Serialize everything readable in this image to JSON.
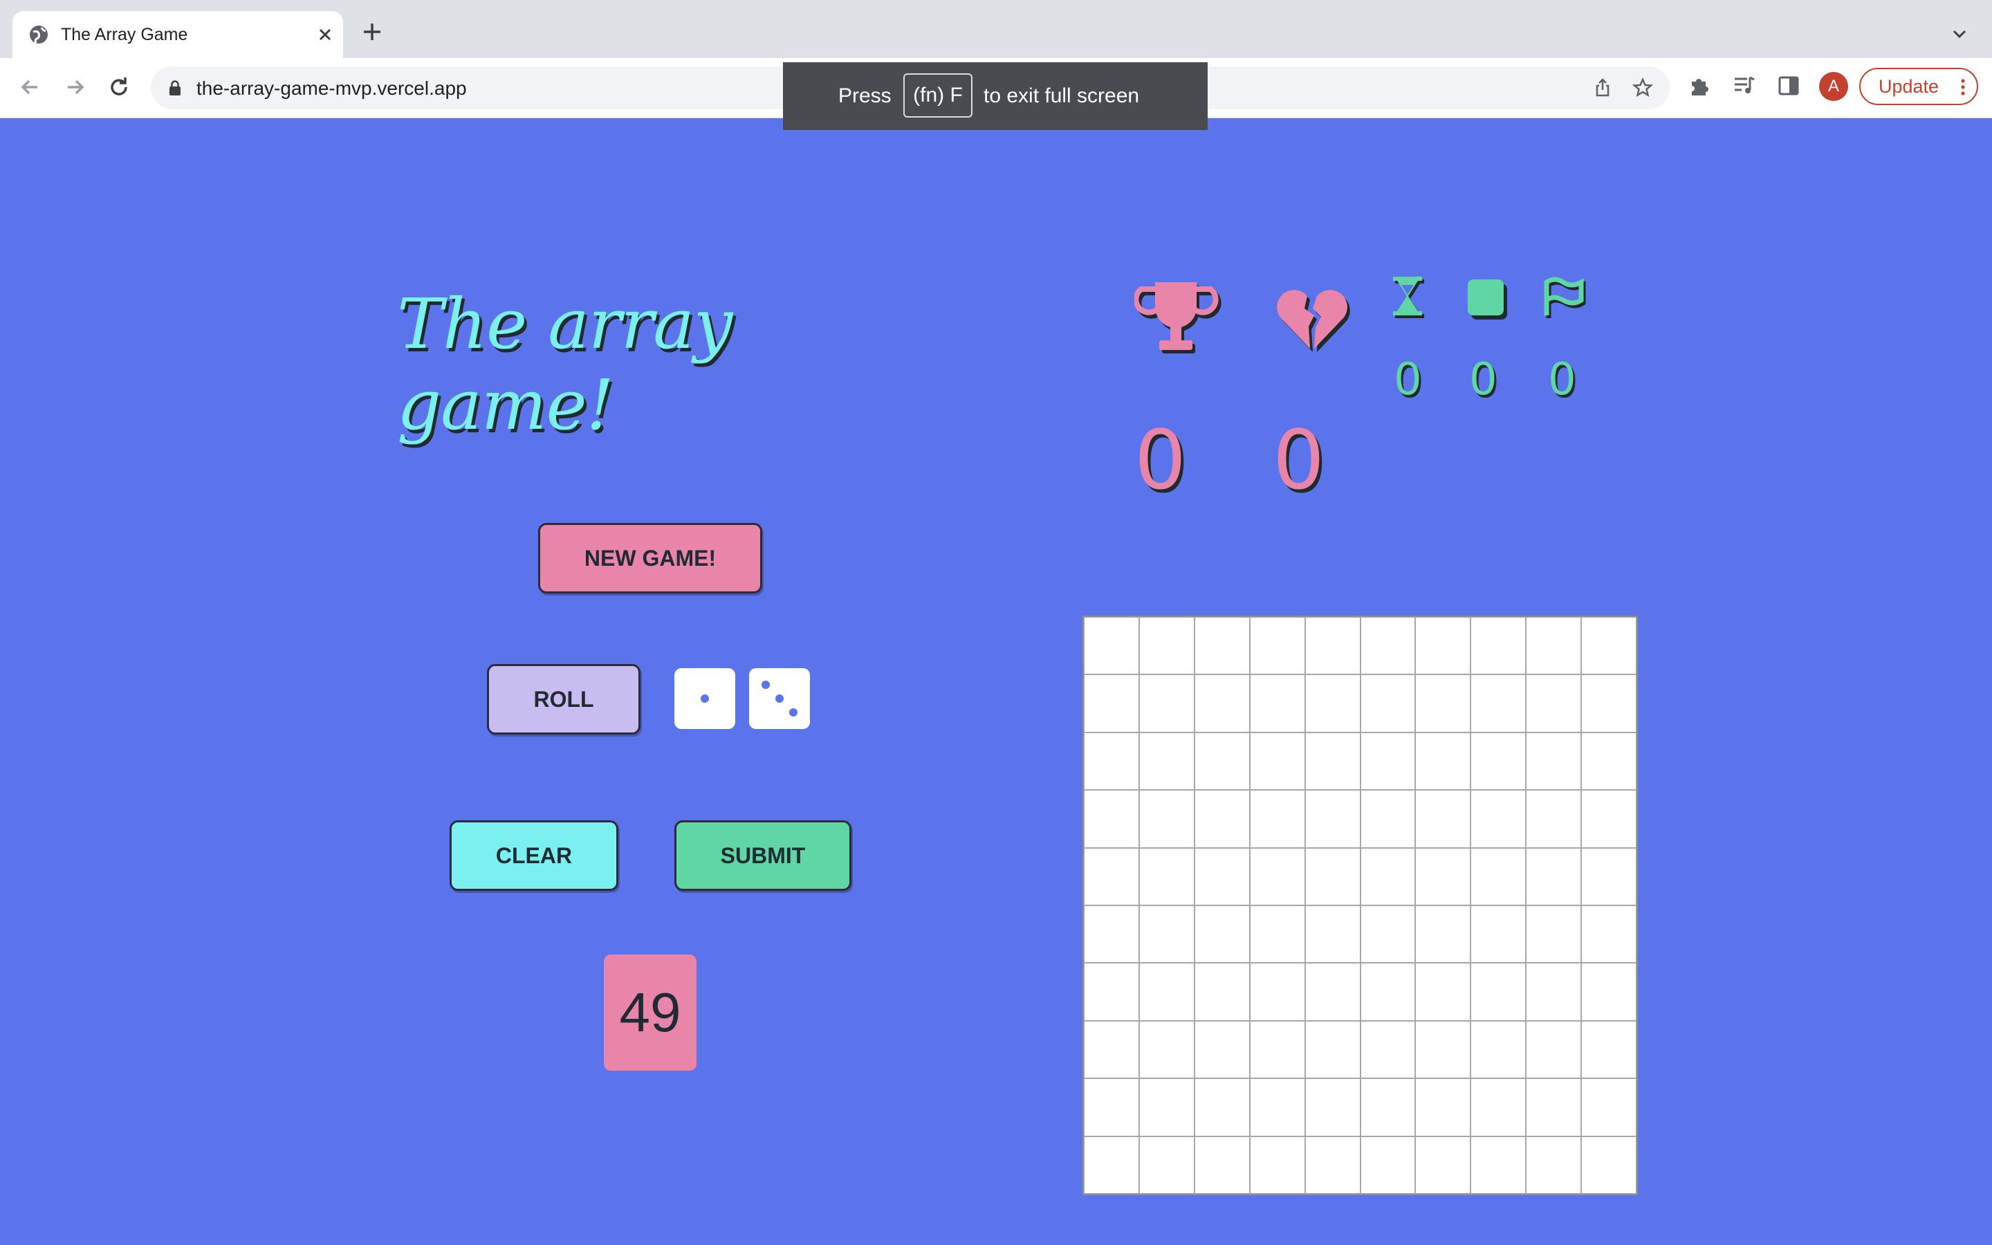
{
  "browser": {
    "tab_title": "The Array Game",
    "url": "the-array-game-mvp.vercel.app",
    "profile_initial": "A",
    "update_label": "Update"
  },
  "fullscreen_hint": {
    "press": "Press",
    "key": "(fn) F",
    "rest": "to exit full screen"
  },
  "game": {
    "title": "The array game!",
    "stats": {
      "wins": "0",
      "losses": "0",
      "timer": "0",
      "squares": "0",
      "flags": "0"
    },
    "buttons": {
      "new_game": "NEW GAME!",
      "roll": "ROLL",
      "clear": "CLEAR",
      "submit": "SUBMIT"
    },
    "dice": [
      1,
      3
    ],
    "target_number": "49",
    "grid": {
      "rows": 10,
      "cols": 10
    }
  },
  "colors": {
    "background": "#5b73eb",
    "pink": "#e985a9",
    "cyan": "#7af0f0",
    "green": "#5fd6a3",
    "lavender": "#c9bcf1"
  },
  "icons": [
    "trophy-icon",
    "broken-heart-icon",
    "hourglass-icon",
    "square-icon",
    "flag-icon"
  ]
}
